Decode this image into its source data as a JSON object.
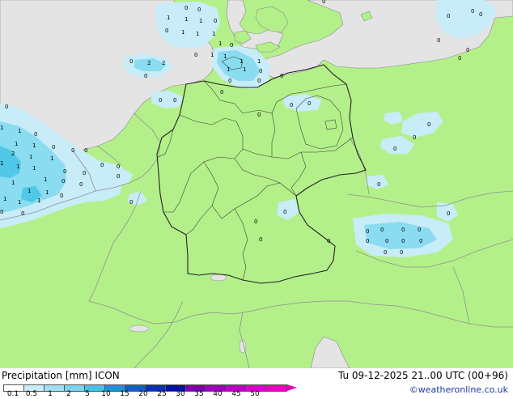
{
  "map": {
    "land_color": "#b4f08a",
    "sea_color": "#e4e4e4",
    "rain_light_color": "#c8ecf8",
    "rain_medium_color": "#8adcf0",
    "rain_heavy_color": "#50c8e8",
    "point_labels": [
      "0",
      "1",
      "2"
    ]
  },
  "footer": {
    "title": "Precipitation [mm]  ICON",
    "valid_time": "Tu 09-12-2025 21..00 UTC (00+96)",
    "credit": "©weatheronline.co.uk",
    "scale_labels": [
      "0.1",
      "0.5",
      "1",
      "2",
      "5",
      "10",
      "15",
      "20",
      "25",
      "30",
      "35",
      "40",
      "45",
      "50"
    ],
    "scale_colors": [
      "#ffffff",
      "#c8ecf8",
      "#a0e0f4",
      "#78d4f0",
      "#48c0e8",
      "#2090d8",
      "#1060c8",
      "#0830b0",
      "#0010a0",
      "#8000b0",
      "#a000c0",
      "#c000c8",
      "#e000d0",
      "#f000c0"
    ],
    "arrow_color": "#ee00aa"
  }
}
